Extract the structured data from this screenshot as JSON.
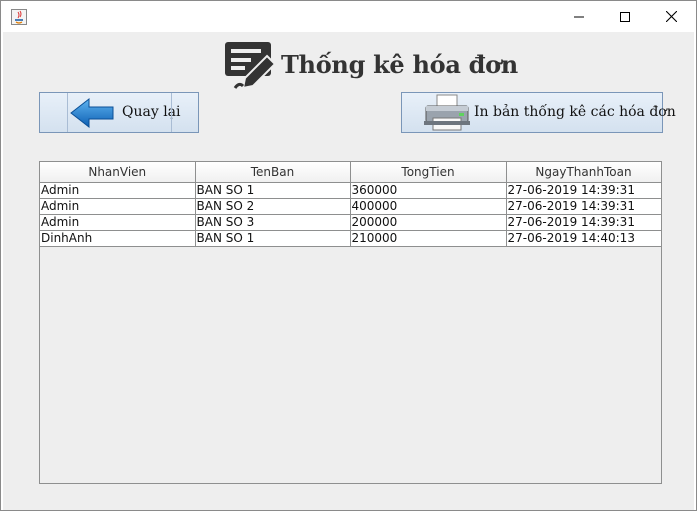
{
  "header": {
    "title": "Thống kê hóa đơn"
  },
  "buttons": {
    "back_label": "Quay lại",
    "print_label": "In bản thống kê các hóa đơn"
  },
  "icons": {
    "app": "java-icon",
    "header": "document-pen-icon",
    "back": "left-arrow-icon",
    "print": "printer-icon"
  },
  "colors": {
    "header_icon": "#333333",
    "back_arrow": "#1d7fd0",
    "button_border": "#7a96b8"
  },
  "table": {
    "columns": [
      "NhanVien",
      "TenBan",
      "TongTien",
      "NgayThanhToan"
    ],
    "rows": [
      [
        "Admin",
        "BAN SO 1",
        "360000",
        "27-06-2019 14:39:31"
      ],
      [
        "Admin",
        "BAN SO 2",
        "400000",
        "27-06-2019 14:39:31"
      ],
      [
        "Admin",
        "BAN SO 3",
        "200000",
        "27-06-2019 14:39:31"
      ],
      [
        "DinhAnh",
        "BAN SO 1",
        "210000",
        "27-06-2019 14:40:13"
      ]
    ]
  }
}
